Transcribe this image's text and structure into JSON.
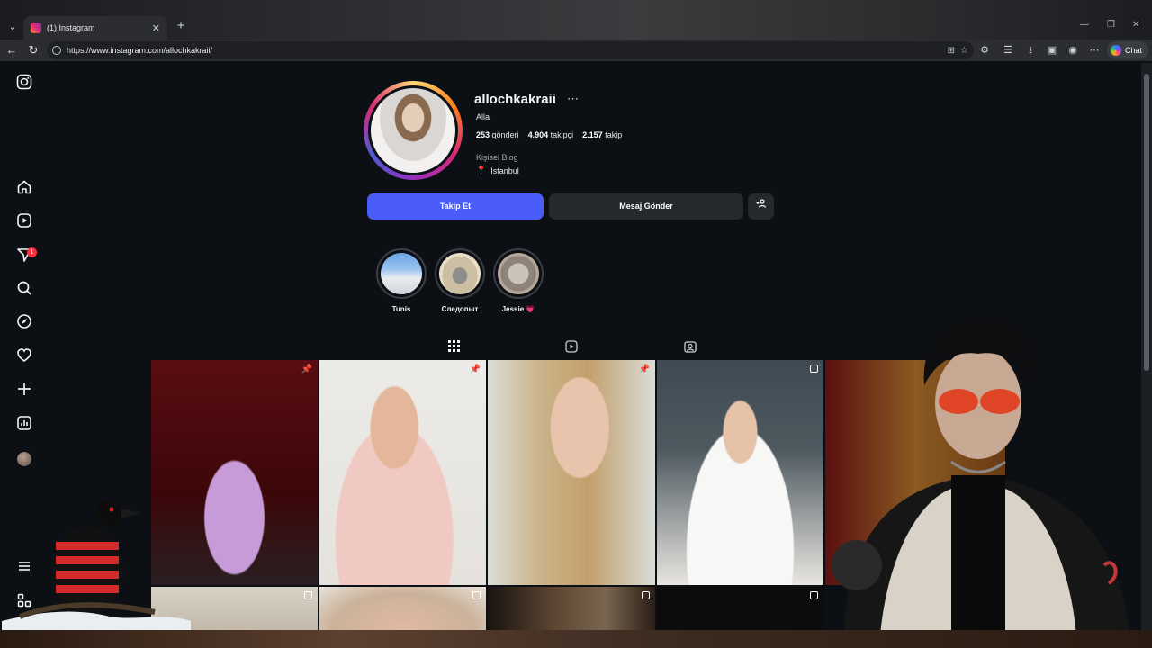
{
  "browser": {
    "tab_title": "(1) Instagram",
    "url": "https://www.instagram.com/allochkakraii/",
    "chat_label": "Chat"
  },
  "sidebar": {
    "notification_count": "1"
  },
  "profile": {
    "username": "allochkakraii",
    "full_name": "Alla",
    "posts_count": "253",
    "posts_label": "gönderi",
    "followers_count": "4.904",
    "followers_label": "takipçi",
    "following_count": "2.157",
    "following_label": "takip",
    "category": "Kişisel Blog",
    "location": "Istanbul",
    "follow_label": "Takip Et",
    "message_label": "Mesaj Gönder"
  },
  "highlights": [
    {
      "label": "Tunis"
    },
    {
      "label": "Следопыт"
    },
    {
      "label": "Jessie 💗"
    }
  ],
  "colors": {
    "accent": "#4a5df9",
    "background": "#0c0f14",
    "secondary_button": "#25292e",
    "badge": "#ff3040"
  }
}
